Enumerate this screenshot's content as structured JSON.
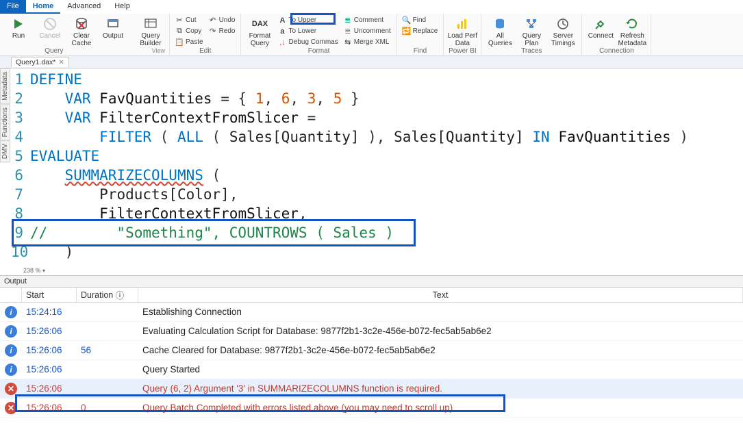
{
  "menu": {
    "file": "File",
    "home": "Home",
    "advanced": "Advanced",
    "help": "Help"
  },
  "ribbon": {
    "query": {
      "run": "Run",
      "cancel": "Cancel",
      "clear_cache": "Clear\nCache",
      "output": "Output",
      "builder": "Query\nBuilder",
      "label": "Query"
    },
    "edit": {
      "cut": "Cut",
      "copy": "Copy",
      "paste": "Paste",
      "undo": "Undo",
      "redo": "Redo",
      "label": "Edit"
    },
    "format": {
      "dax": "Format\nQuery",
      "upper": "To Upper",
      "lower": "To Lower",
      "debug": "Debug Commas",
      "comment": "Comment",
      "uncomment": "Uncomment",
      "merge": "Merge XML",
      "label": "Format"
    },
    "find": {
      "find": "Find",
      "replace": "Replace",
      "label": "Find"
    },
    "powerbi": {
      "load": "Load Perf\nData",
      "label": "Power BI"
    },
    "traces": {
      "all": "All\nQueries",
      "plan": "Query\nPlan",
      "timings": "Server\nTimings",
      "label": "Traces"
    },
    "connection": {
      "connect": "Connect",
      "refresh": "Refresh\nMetadata",
      "label": "Connection"
    }
  },
  "doc_tab": "Query1.dax*",
  "side": {
    "metadata": "Metadata",
    "functions": "Functions",
    "dmv": "DMV"
  },
  "code": {
    "l1": {
      "kw": "DEFINE"
    },
    "l2": {
      "var": "VAR",
      "name": "FavQuantities",
      "eq": "=",
      "open": "{",
      "n1": "1",
      "n2": "6",
      "n3": "3",
      "n4": "5",
      "close": "}"
    },
    "l3": {
      "var": "VAR",
      "name": "FilterContextFromSlicer",
      "eq": "="
    },
    "l4": {
      "fn1": "FILTER",
      "fn2": "ALL",
      "col": "Sales[Quantity]",
      "in": "IN",
      "name2": "FavQuantities"
    },
    "l5": {
      "kw": "EVALUATE"
    },
    "l6": {
      "fn": "SUMMARIZECOLUMNS"
    },
    "l7": {
      "col": "Products[Color]"
    },
    "l8": {
      "name": "FilterContextFromSlicer"
    },
    "l9": {
      "cmt": "//        \"Something\", COUNTROWS ( Sales )"
    },
    "l10": {
      "close": ")"
    }
  },
  "zoom": "238 %",
  "output": {
    "title": "Output",
    "headers": {
      "start": "Start",
      "duration": "Duration",
      "info": "ⓘ",
      "text": "Text"
    },
    "rows": [
      {
        "type": "info",
        "start": "15:24:16",
        "dur": "",
        "text": "Establishing Connection"
      },
      {
        "type": "info",
        "start": "15:26:06",
        "dur": "",
        "text": "Evaluating Calculation Script for Database: 9877f2b1-3c2e-456e-b072-fec5ab5ab6e2"
      },
      {
        "type": "info",
        "start": "15:26:06",
        "dur": "56",
        "text": "Cache Cleared for Database: 9877f2b1-3c2e-456e-b072-fec5ab5ab6e2"
      },
      {
        "type": "info",
        "start": "15:26:06",
        "dur": "",
        "text": "Query Started"
      },
      {
        "type": "err",
        "start": "15:26:06",
        "dur": "",
        "text": "Query (6, 2) Argument '3' in SUMMARIZECOLUMNS function is required."
      },
      {
        "type": "err",
        "start": "15:26:06",
        "dur": "0",
        "text": "Query Batch Completed with errors listed above (you may need to scroll up)"
      }
    ]
  }
}
